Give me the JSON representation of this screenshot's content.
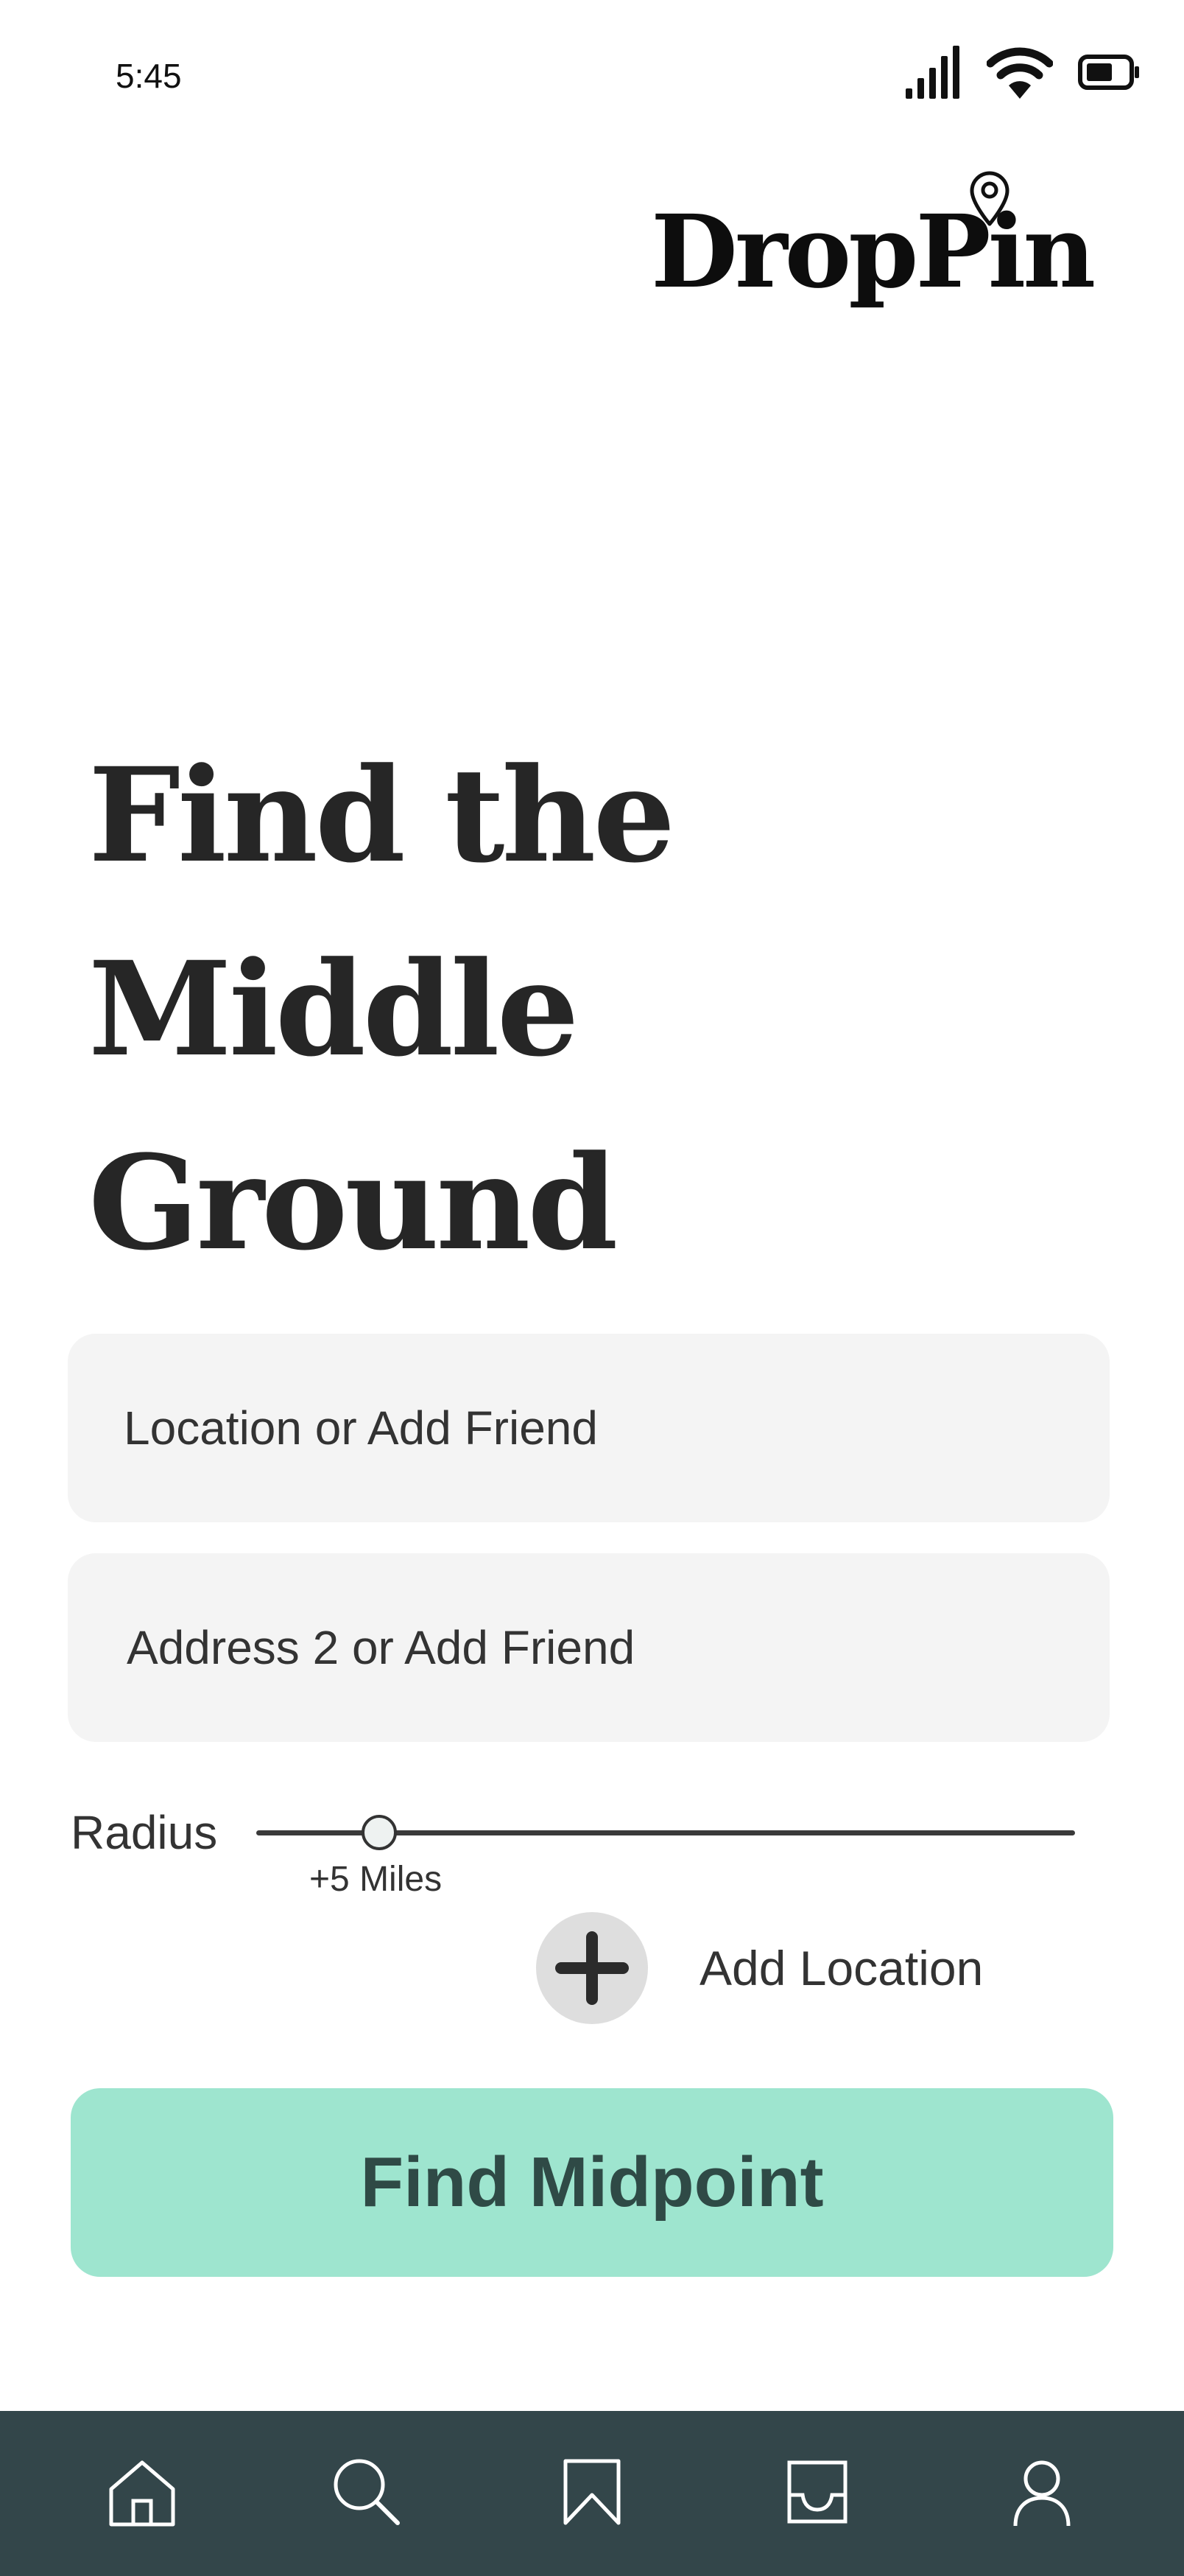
{
  "status_bar": {
    "time": "5:45",
    "icons": [
      "signal-icon",
      "wifi-icon",
      "battery-icon"
    ]
  },
  "brand": {
    "name": "DropPin",
    "icon": "map-pin-icon"
  },
  "hero": {
    "title_line1": "Find the",
    "title_line2": "Middle",
    "title_line3": "Ground"
  },
  "form": {
    "location1_placeholder": "Location or Add Friend",
    "location2_placeholder": "Address 2 or Add Friend",
    "radius_label": "Radius",
    "radius_value": "+5 Miles",
    "radius_fraction": 0.15,
    "add_location_label": "Add Location",
    "add_location_icon": "plus-icon",
    "submit_label": "Find Midpoint"
  },
  "bottom_nav": {
    "items": [
      "home-icon",
      "search-icon",
      "bookmark-icon",
      "inbox-icon",
      "profile-icon"
    ]
  },
  "colors": {
    "accent": "#9ee5cf",
    "nav_background": "#33464a",
    "field_background": "#f4f4f4",
    "text": "#2b2b2b"
  }
}
